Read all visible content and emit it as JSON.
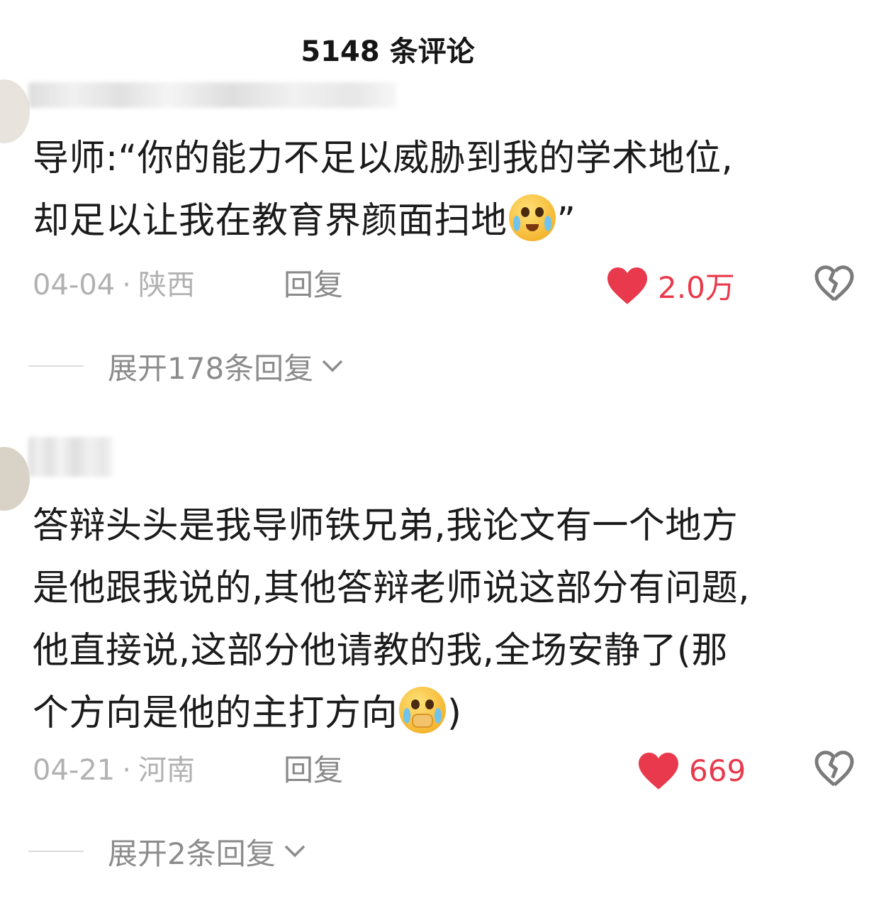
{
  "header": {
    "title": "5148 条评论"
  },
  "comments": [
    {
      "content_line1": "导师:“你的能力不足以威胁到我的学术地位,",
      "content_line2": "却足以让我在教育界颜面扫地",
      "content_tail": "”",
      "emoji": "crying-laughing-emoji",
      "date": "04-04",
      "location": "陕西",
      "reply_label": "回复",
      "like_count": "2.0万",
      "expand_label": "展开178条回复"
    },
    {
      "content_line1": "答辩头头是我导师铁兄弟,我论文有一个地方",
      "content_line2": "是他跟我说的,其他答辩老师说这部分有问题,",
      "content_line3": "他直接说,这部分他请教的我,全场安静了(那",
      "content_line4": "个方向是他的主打方向",
      "content_tail": ")",
      "emoji": "pleading-face-emoji",
      "date": "04-21",
      "location": "河南",
      "reply_label": "回复",
      "like_count": "669",
      "expand_label": "展开2条回复"
    }
  ],
  "colors": {
    "like_red": "#e83a4c",
    "meta_gray": "#b1b1b1",
    "text": "#1b1b1b"
  },
  "icons": {
    "like": "heart-filled-icon",
    "dislike": "broken-heart-icon",
    "expand": "chevron-down-icon"
  }
}
